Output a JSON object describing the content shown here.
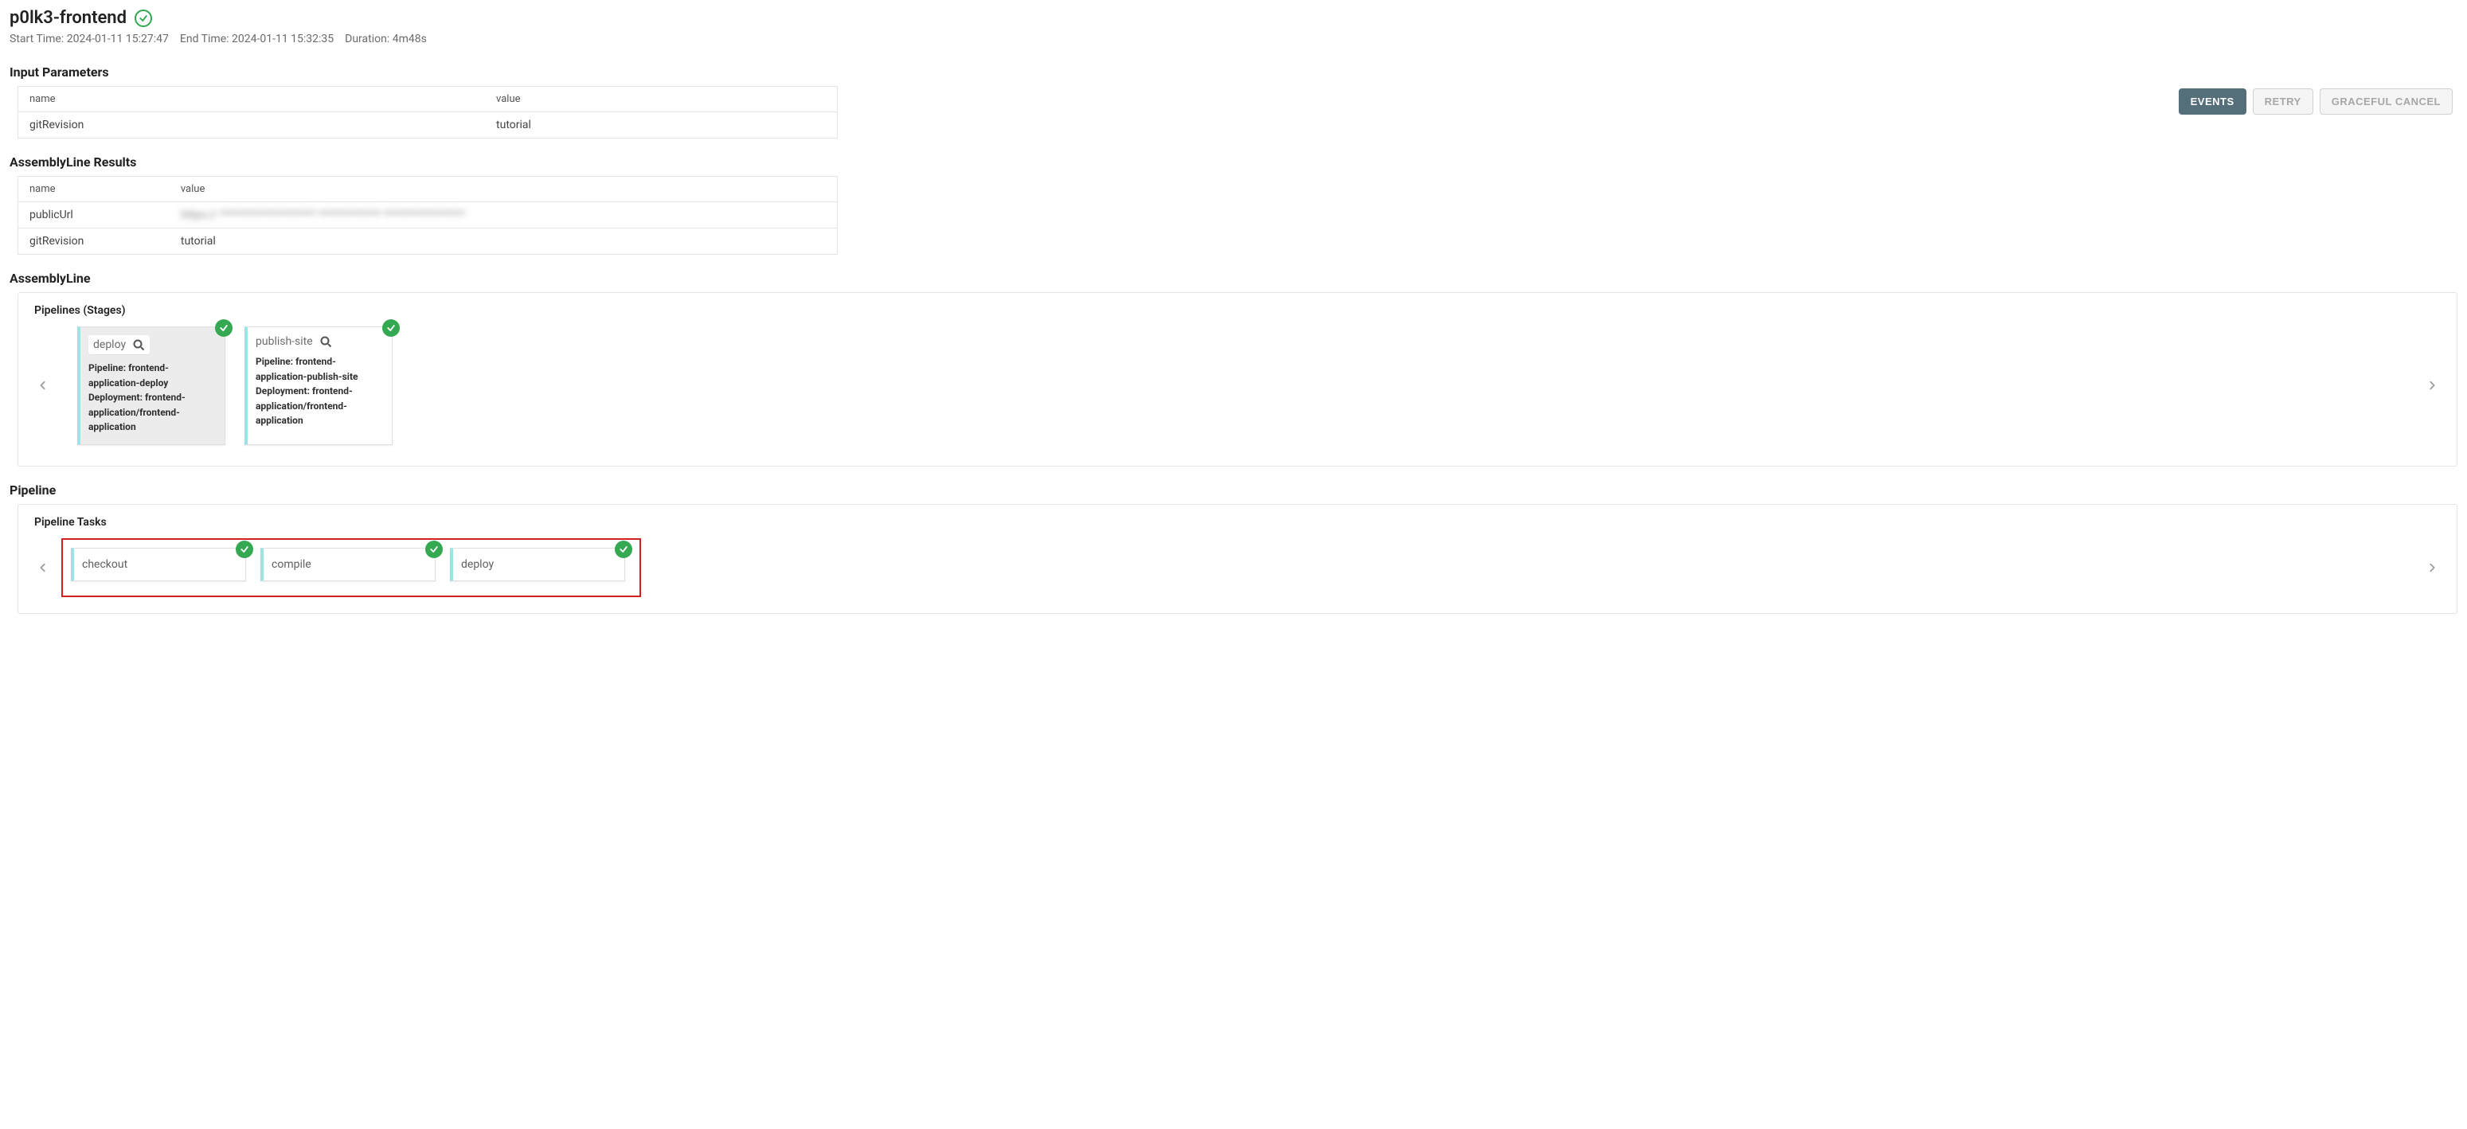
{
  "header": {
    "title": "p0lk3-frontend",
    "start_label": "Start Time:",
    "start_value": "2024-01-11 15:27:47",
    "end_label": "End Time:",
    "end_value": "2024-01-11 15:32:35",
    "duration_label": "Duration:",
    "duration_value": "4m48s"
  },
  "buttons": {
    "events": "EVENTS",
    "retry": "RETRY",
    "graceful_cancel": "GRACEFUL CANCEL"
  },
  "input_parameters": {
    "title": "Input Parameters",
    "columns": {
      "name": "name",
      "value": "value"
    },
    "rows": [
      {
        "name": "gitRevision",
        "value": "tutorial"
      }
    ]
  },
  "results": {
    "title": "AssemblyLine Results",
    "columns": {
      "name": "name",
      "value": "value"
    },
    "rows": [
      {
        "name": "publicUrl",
        "value": "https:// ******************** ************* *****************"
      },
      {
        "name": "gitRevision",
        "value": "tutorial"
      }
    ]
  },
  "assemblyline": {
    "title": "AssemblyLine",
    "panel_label": "Pipelines (Stages)",
    "stages": [
      {
        "name": "deploy",
        "pipeline_label": "Pipeline:",
        "pipeline_value": "frontend-application-deploy",
        "deployment_label": "Deployment:",
        "deployment_value": "frontend-application/frontend-application",
        "selected": true
      },
      {
        "name": "publish-site",
        "pipeline_label": "Pipeline:",
        "pipeline_value": "frontend-application-publish-site",
        "deployment_label": "Deployment:",
        "deployment_value": "frontend-application/frontend-application",
        "selected": false
      }
    ]
  },
  "pipeline": {
    "title": "Pipeline",
    "panel_label": "Pipeline Tasks",
    "tasks": [
      {
        "name": "checkout"
      },
      {
        "name": "compile"
      },
      {
        "name": "deploy"
      }
    ]
  }
}
